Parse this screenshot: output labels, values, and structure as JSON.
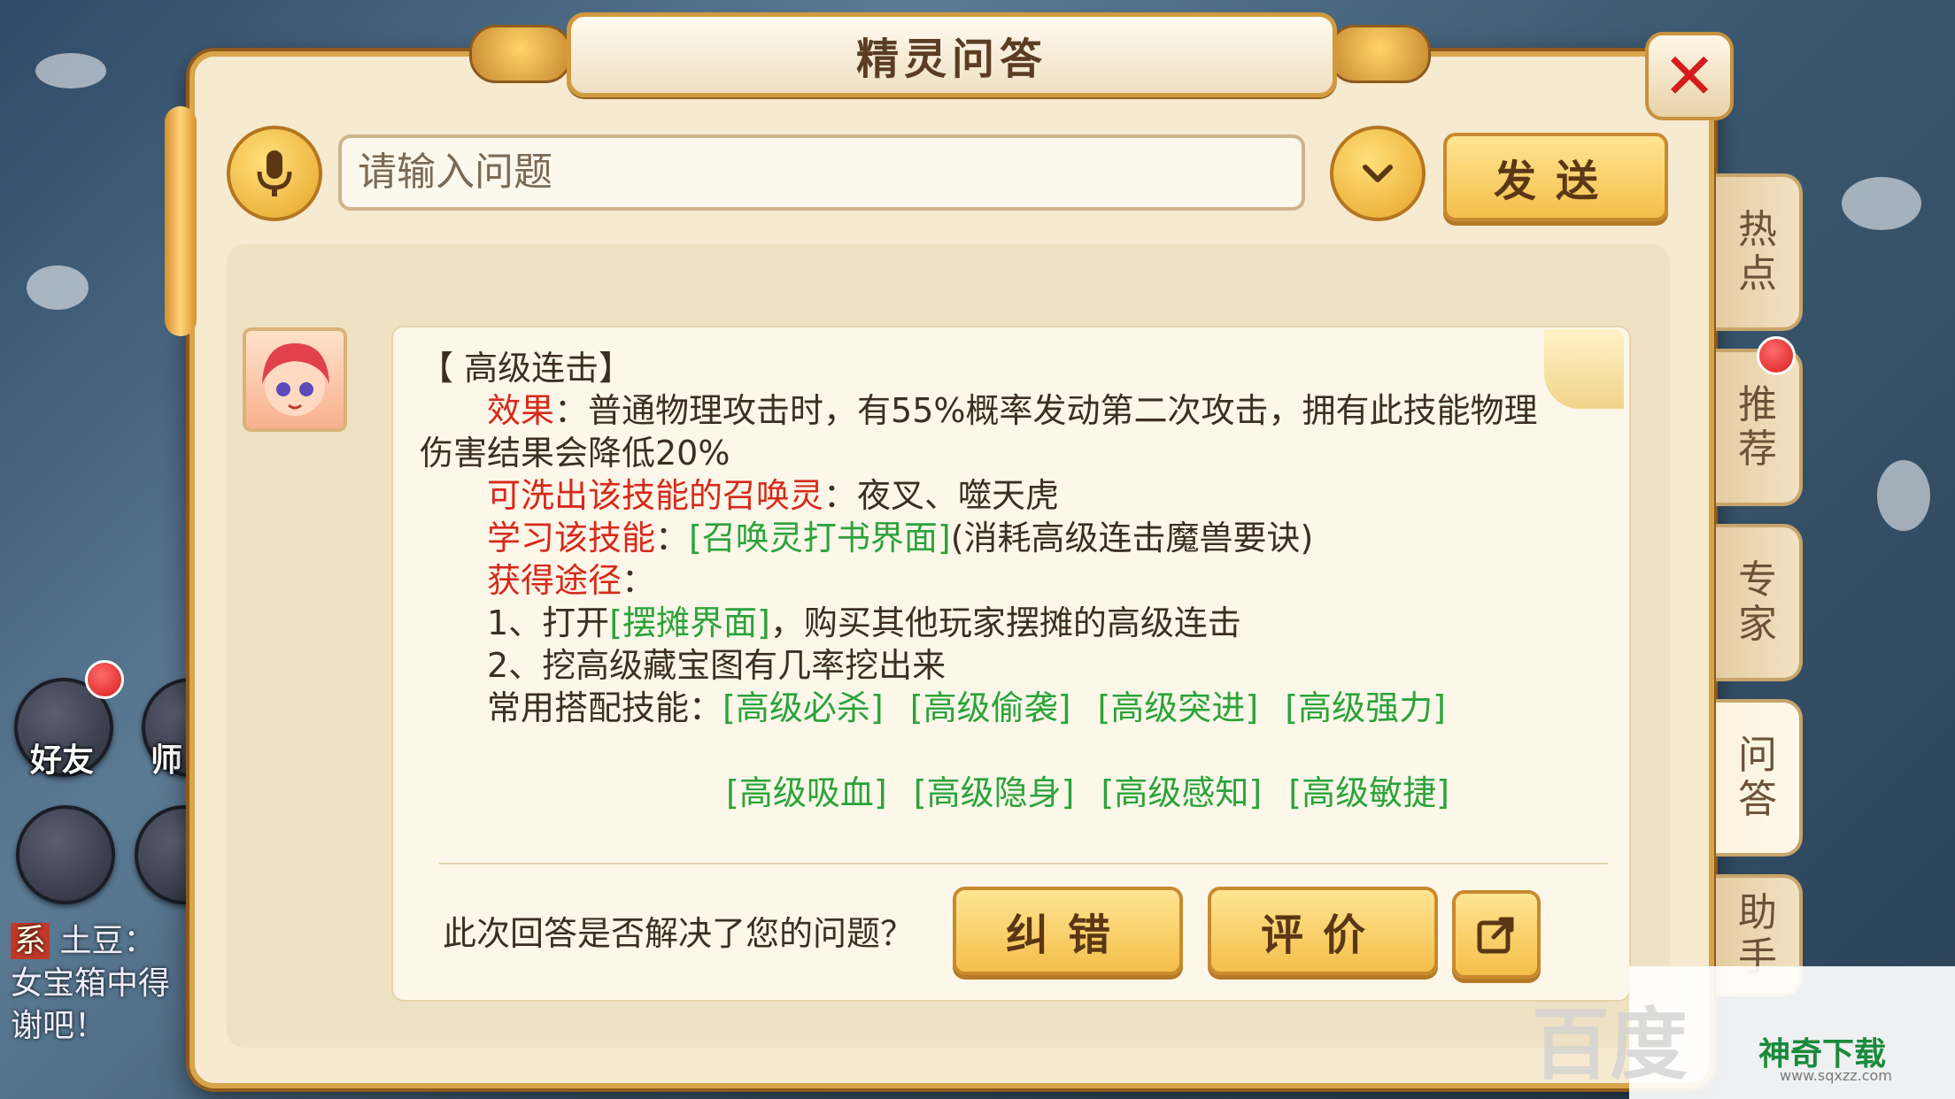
{
  "dialog": {
    "title": "精灵问答",
    "close_glyph": "✕"
  },
  "search": {
    "placeholder": "请输入问题",
    "send_label": "发送"
  },
  "side_tabs": [
    "热点",
    "推荐",
    "专家",
    "问答",
    "助手"
  ],
  "answer": {
    "heading": "【 高级连击】",
    "effect_label": "效果",
    "effect_text": "：普通物理攻击时，有55%概率发动第二次攻击，拥有此技能物理",
    "effect_text_2": "伤害结果会降低20%",
    "summon_label": "可洗出该技能的召唤灵",
    "summon_text": "：夜叉、噬天虎",
    "learn_label": "学习该技能",
    "learn_sep": "：",
    "learn_link": "[召唤灵打书界面]",
    "learn_text": "(消耗高级连击魔兽要诀)",
    "obtain_label": "获得途径",
    "obtain_sep": "：",
    "obtain_1_prefix": "1、打开",
    "obtain_1_link": "[摆摊界面]",
    "obtain_1_text": "，购买其他玩家摆摊的高级连击",
    "obtain_2": "2、挖高级藏宝图有几率挖出来",
    "combo_label": "常用搭配技能：",
    "combo_skills_row1": [
      "[高级必杀]",
      "[高级偷袭]",
      "[高级突进]",
      "[高级强力]"
    ],
    "combo_skills_row2": [
      "[高级吸血]",
      "[高级隐身]",
      "[高级感知]",
      "[高级敏捷]"
    ]
  },
  "feedback": {
    "question": "此次回答是否解决了您的问题？",
    "correct_label": "纠错",
    "rate_label": "评价"
  },
  "hud": {
    "friends_label": "好友",
    "master_label": "师",
    "chat_tag": "系",
    "chat_name": "土豆：",
    "chat_line2": "女宝箱中得",
    "chat_line3": "谢吧！"
  },
  "watermark": {
    "baidu": "百度",
    "brand": "神奇下载",
    "url": "www.sqxzz.com"
  },
  "colors": {
    "accent_gold": "#f4bf4a",
    "label_red": "#d62a1b",
    "link_green": "#2ba33a",
    "close_red": "#d41d1d"
  }
}
